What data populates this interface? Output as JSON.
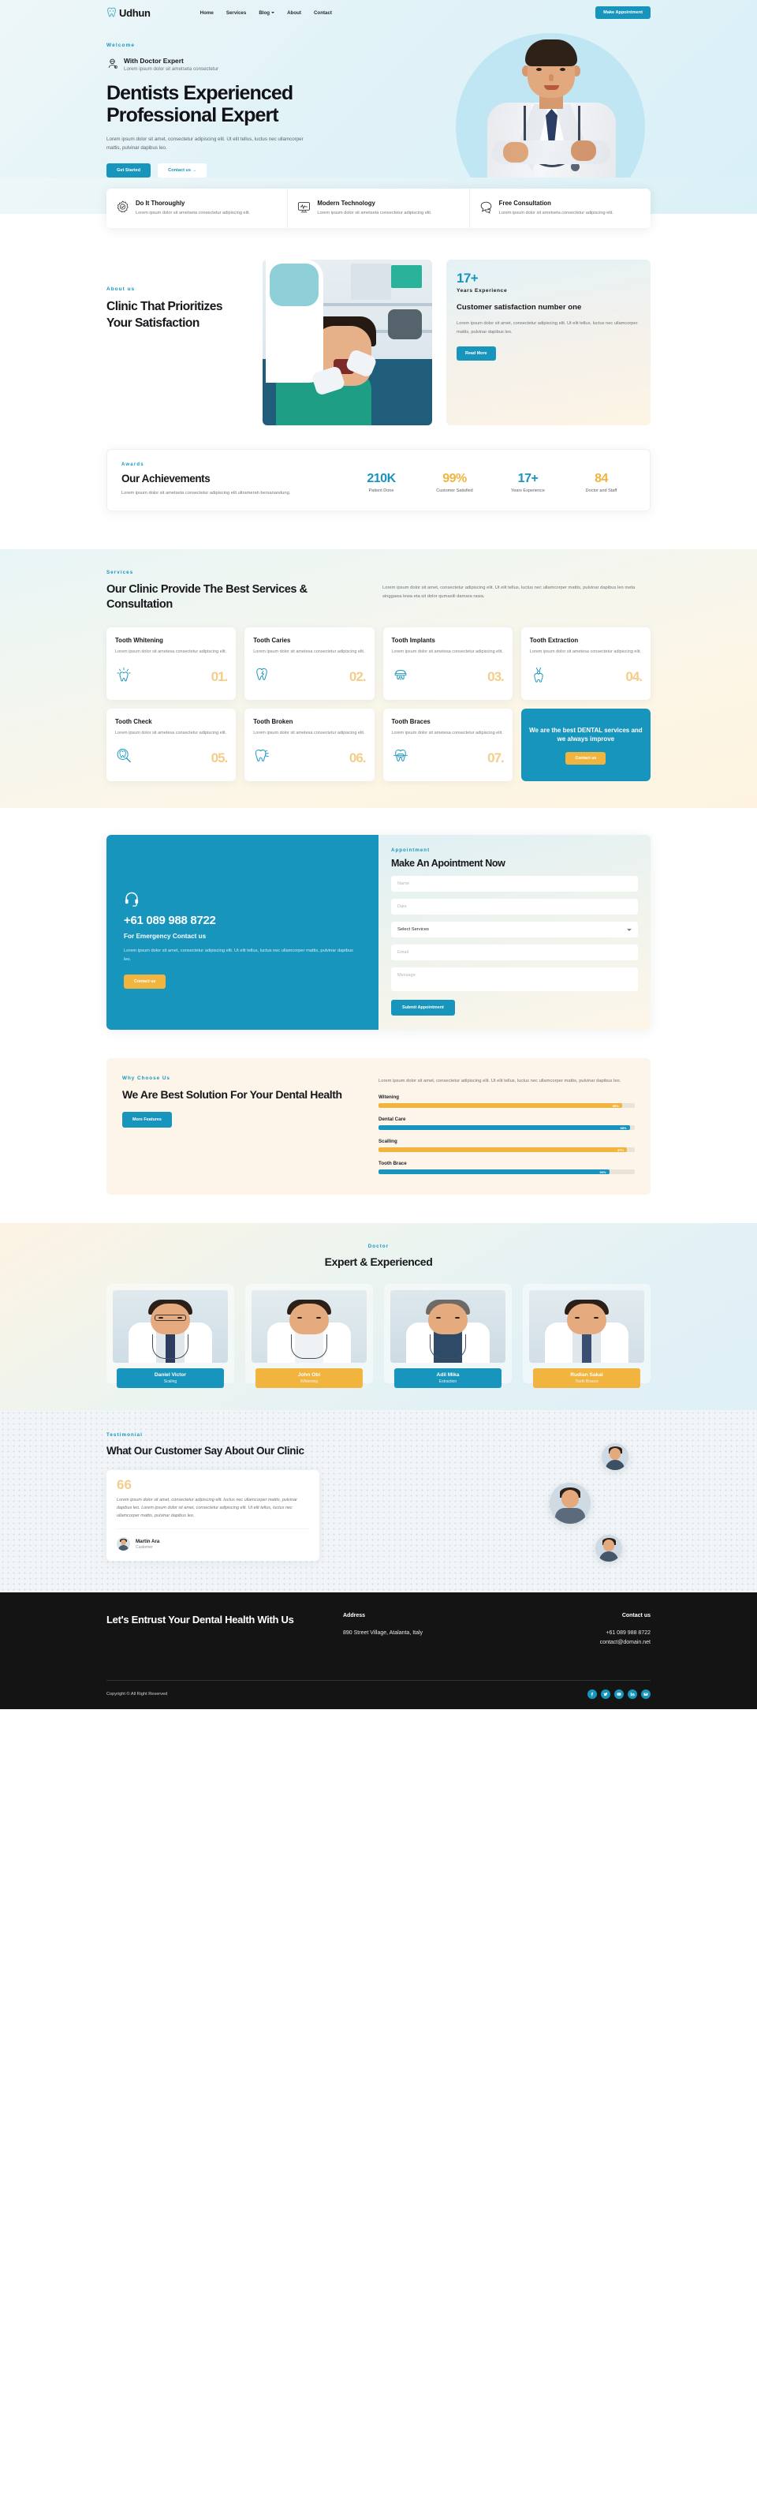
{
  "header": {
    "brand": "Udhun",
    "brand_icon": "tooth-logo-icon",
    "nav": [
      {
        "label": "Home"
      },
      {
        "label": "Services"
      },
      {
        "label": "Blog",
        "has_caret": true
      },
      {
        "label": "About"
      },
      {
        "label": "Contact"
      }
    ],
    "cta": "Make Appointment"
  },
  "hero": {
    "eyebrow": "Welcome",
    "doctor_title": "With Doctor Expert",
    "doctor_sub": "Lorem ipsum dolor sit ametseta consectetur",
    "heading_line1": "Dentists Experienced",
    "heading_line2": "Professional Expert",
    "paragraph": "Lorem ipsum dolor sit amet, consectetur adipiscing elit. Ut elit tellus, luctus nec ullamcorper mattis, pulvinar dapibus leo.",
    "btn_primary": "Get Started",
    "btn_ghost": "Contact us  →"
  },
  "features": [
    {
      "icon": "badge-check-icon",
      "title": "Do It Thoroughly",
      "text": "Lorem ipsum dolor sit ametseta consectetur adipiscing elit."
    },
    {
      "icon": "monitor-pulse-icon",
      "title": "Modern Technology",
      "text": "Lorem ipsum dolor sit ametseta consectetur adipiscing elit."
    },
    {
      "icon": "chat-bubbles-icon",
      "title": "Free Consultation",
      "text": "Lorem ipsum dolor sit ametseta consectetur adipiscing elit."
    }
  ],
  "about": {
    "eyebrow": "About us",
    "heading": "Clinic That Prioritizes Your Satisfaction",
    "stat_number": "17+",
    "stat_label": "Years Experience",
    "card_heading": "Customer satisfaction number one",
    "card_text": "Lorem ipsum dolor sit amet, consectetur adipiscing elit. Ut elit tellus, luctus nec ullamcorper mattis, pulvinar dapibus leo.",
    "btn": "Read More"
  },
  "achievements": {
    "eyebrow": "Awards",
    "heading": "Our Achievements",
    "text": "Lorem ipsum dolor sit ametseta consectetur adipiscing elit ultramerah bersanandung.",
    "stats": [
      {
        "number": "210K",
        "label": "Patient Done",
        "color": "blue"
      },
      {
        "number": "99%",
        "label": "Customer Satisfied",
        "color": "gold"
      },
      {
        "number": "17+",
        "label": "Years Experience",
        "color": "blue"
      },
      {
        "number": "84",
        "label": "Doctor and Staff",
        "color": "gold"
      }
    ]
  },
  "services": {
    "eyebrow": "Services",
    "heading": "Our Clinic Provide The Best Services & Consultation",
    "text": "Lorem ipsum dolor sit amet, consectetur adipiscing elit. Ut elit tellus, luctus nec ullamcorper mattis, pulvinar dapibus leo meta singgawa lewa eta sit dolor qumasili damara rawa.",
    "cards": [
      {
        "title": "Tooth Whitening",
        "text": "Lorem ipsum dolor sit ametesa consectetur adipiscing elit.",
        "num": "01.",
        "icon": "tooth-shine-icon"
      },
      {
        "title": "Tooth Caries",
        "text": "Lorem ipsum dolor sit ametesa consectetur adipiscing elit.",
        "num": "02.",
        "icon": "tooth-crack-icon"
      },
      {
        "title": "Tooth Implants",
        "text": "Lorem ipsum dolor sit ametesa consectetur adipiscing elit.",
        "num": "03.",
        "icon": "tooth-implant-icon"
      },
      {
        "title": "Tooth Extraction",
        "text": "Lorem ipsum dolor sit ametesa consectetur adipiscing elit.",
        "num": "04.",
        "icon": "tooth-pliers-icon"
      },
      {
        "title": "Tooth Check",
        "text": "Lorem ipsum dolor sit ametesa consectetur adipiscing elit.",
        "num": "05.",
        "icon": "tooth-magnifier-icon"
      },
      {
        "title": "Tooth Broken",
        "text": "Lorem ipsum dolor sit ametesa consectetur adipiscing elit.",
        "num": "06.",
        "icon": "tooth-broken-icon"
      },
      {
        "title": "Tooth Braces",
        "text": "Lorem ipsum dolor sit ametesa consectetur adipiscing elit.",
        "num": "07.",
        "icon": "tooth-braces-icon"
      }
    ],
    "cta_text": "We are the best DENTAL services and we always improve",
    "cta_btn": "Contact us"
  },
  "appointment": {
    "icon": "headset-icon",
    "phone": "+61 089 988 8722",
    "emergency": "For Emergency Contact us",
    "text": "Lorem ipsum dolor sit amet, consectetur adipiscing elit. Ut elit tellus, luctus nec ullamcorper mattis, pulvinar dapibus leo.",
    "btn_contact": "Contact us",
    "eyebrow": "Appointment",
    "heading": "Make An Apointment Now",
    "ph_name": "Name",
    "ph_date": "Date",
    "select_value": "Select Services",
    "ph_email": "Email",
    "ph_message": "Message",
    "btn_submit": "Submit Appointment"
  },
  "why": {
    "eyebrow": "Why Choose Us",
    "heading": "We Are Best Solution For Your Dental Health",
    "btn": "More Features",
    "text": "Lorem ipsum dolor sit amet, consectetur adipiscing elit. Ut elit tellus, luctus nec ullamcorper mattis, pulvinar dapibus leo.",
    "bars": [
      {
        "label": "Witening",
        "pct": 95,
        "pct_text": "95%",
        "color": "#f0b43f"
      },
      {
        "label": "Dental Care",
        "pct": 98,
        "pct_text": "98%",
        "color": "#1795bd"
      },
      {
        "label": "Scalling",
        "pct": 97,
        "pct_text": "97%",
        "color": "#f0b43f"
      },
      {
        "label": "Tooth Brace",
        "pct": 90,
        "pct_text": "90%",
        "color": "#1795bd"
      }
    ]
  },
  "doctors": {
    "eyebrow": "Doctor",
    "heading": "Expert & Experienced",
    "list": [
      {
        "name": "Daniel Victor",
        "role": "Scaling",
        "tag": "blue"
      },
      {
        "name": "John Obi",
        "role": "Whitening",
        "tag": "gold"
      },
      {
        "name": "Adil Mika",
        "role": "Extraction",
        "tag": "blue"
      },
      {
        "name": "Rudian Sakai",
        "role": "Tooth Braces",
        "tag": "gold"
      }
    ]
  },
  "testimonial": {
    "eyebrow": "Testimonial",
    "heading": "What Our Customer Say About Our Clinic",
    "quote_mark": "66",
    "text": "Lorem ipsum dolor sit amet, consectetur adipiscing elit. luctus nec ullamcorper mattis, pulvinar dapibus leo. Lorem ipsum dolor sit amet, consectetur adipiscing elit. Ut elit tellus, luctus nec ullamcorper mattis, pulvinar dapibus leo.",
    "name": "Martin Ara",
    "role": "Customer"
  },
  "footer": {
    "heading": "Let's Entrust Your Dental Health With Us",
    "address_title": "Address",
    "address_value": "890 Street Village, Atalanta, Italy",
    "contact_title": "Contact us",
    "contact_phone": "+61 089 988 8722",
    "contact_email": "contact@domain.net",
    "copyright": "Copyright © All Right Reserved",
    "socials": [
      "facebook-icon",
      "twitter-icon",
      "youtube-icon",
      "linkedin-icon",
      "email-icon"
    ]
  },
  "colors": {
    "accent_blue": "#1795bd",
    "accent_gold": "#f0b43f",
    "dark": "#141414"
  }
}
